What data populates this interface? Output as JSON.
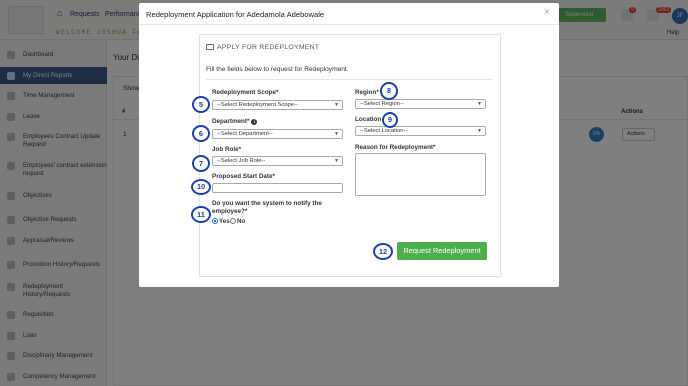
{
  "app": {
    "nav": [
      "Requests",
      "Performance"
    ],
    "welcome": "WELCOME JOSHUA FAL",
    "supervisor_label": "Supervisor",
    "badge_inbox": "9",
    "badge_bell": "2063",
    "avatar_initials": "JF",
    "help_label": "Help",
    "main_title": "Your Di",
    "show_label": "Show",
    "table_cols": [
      "#",
      "Actions"
    ],
    "row_num": "1",
    "row_progress": "0%",
    "row_action": "Actions"
  },
  "sidebar": {
    "items": [
      {
        "label": "Dashboard"
      },
      {
        "label": "My Direct Reports"
      },
      {
        "label": "Time Management"
      },
      {
        "label": "Leave"
      },
      {
        "label": "Employees Contract Update Request"
      },
      {
        "label": "Employees' contract extension request"
      },
      {
        "label": "Objectives"
      },
      {
        "label": "Objective Requests"
      },
      {
        "label": "Appraisal/Reviews"
      },
      {
        "label": "Promotion History/Requests"
      },
      {
        "label": "Redeployment History/Requests"
      },
      {
        "label": "Requisition"
      },
      {
        "label": "Loan"
      },
      {
        "label": "Disciplinary Management"
      },
      {
        "label": "Competency Management"
      }
    ]
  },
  "modal": {
    "title": "Redeployment Application for Adedamola Adebowale",
    "close_symbol": "×",
    "section_title": "APPLY FOR REDEPLOYMENT",
    "description": "Fill the fields below to request for Redeployment.",
    "fields": {
      "scope": {
        "label": "Redeployment Scope*",
        "value": "--Select Redeployment Scope--"
      },
      "department": {
        "label": "Department*",
        "value": "--Select Department--"
      },
      "job_role": {
        "label": "Job Role*",
        "value": "--Select Job Role--"
      },
      "start_date": {
        "label": "Proposed Start Date*"
      },
      "notify": {
        "label_line1": "Do you want the system to notify the",
        "label_line2": "employee?*",
        "yes": "Yes",
        "no": "No"
      },
      "region": {
        "label": "Region*",
        "value": "--Select Region--"
      },
      "location": {
        "label": "Location",
        "value": "--Select Location--"
      },
      "reason": {
        "label": "Reason for Redeployment*"
      }
    },
    "submit_label": "Request Redeployment"
  },
  "callouts": [
    "5",
    "6",
    "7",
    "10",
    "11",
    "8",
    "9",
    "12"
  ]
}
